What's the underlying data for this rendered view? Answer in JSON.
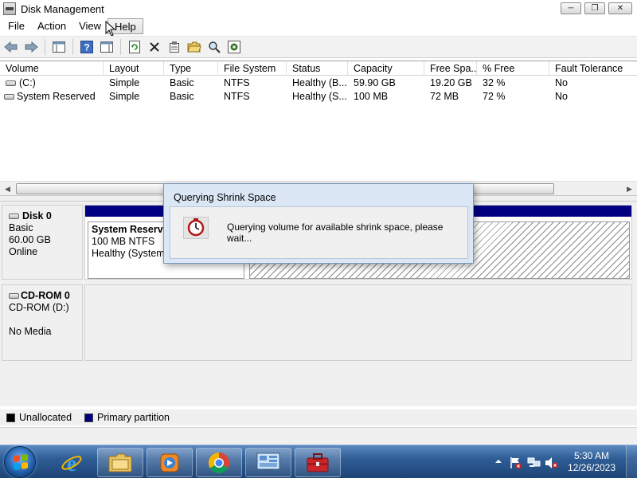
{
  "window": {
    "title": "Disk Management",
    "minimize_glyph": "─",
    "maximize_glyph": "❐",
    "close_glyph": "✕"
  },
  "menu": [
    "File",
    "Action",
    "View",
    "Help"
  ],
  "toolbar_icons": [
    "back-arrow-icon",
    "forward-arrow-icon",
    "show-hide-console-tree-icon",
    "help-icon",
    "show-hide-action-pane-icon",
    "refresh-icon",
    "delete-icon",
    "properties-icon",
    "open-folder-icon",
    "search-icon",
    "settings-icon"
  ],
  "volume_table": {
    "columns": [
      "Volume",
      "Layout",
      "Type",
      "File System",
      "Status",
      "Capacity",
      "Free Spa...",
      "% Free",
      "Fault Tolerance"
    ],
    "rows": [
      [
        "(C:)",
        "Simple",
        "Basic",
        "NTFS",
        "Healthy (B...",
        "59.90 GB",
        "19.20 GB",
        "32 %",
        "No"
      ],
      [
        "System Reserved",
        "Simple",
        "Basic",
        "NTFS",
        "Healthy (S...",
        "100 MB",
        "72 MB",
        "72 %",
        "No"
      ]
    ]
  },
  "disks": {
    "disk0": {
      "name": "Disk 0",
      "type": "Basic",
      "size": "60.00 GB",
      "state": "Online",
      "partition": {
        "name": "System Reserve",
        "size_fs": "100 MB NTFS",
        "status": "Healthy (System,"
      }
    },
    "cdrom0": {
      "name": "CD-ROM 0",
      "drive": "CD-ROM (D:)",
      "media": "No Media"
    }
  },
  "legend": [
    {
      "label": "Unallocated",
      "color": "#000000"
    },
    {
      "label": "Primary partition",
      "color": "#000080"
    }
  ],
  "dialog": {
    "title": "Querying Shrink Space",
    "message": "Querying volume for available shrink space, please wait...",
    "icon": "clock-icon"
  },
  "taskbar": {
    "apps": [
      "internet-explorer-icon",
      "file-explorer-icon",
      "media-player-icon",
      "chrome-icon",
      "computer-management-icon",
      "toolbox-icon"
    ],
    "tray_icons": [
      "show-hidden-icons-arrow",
      "action-center-icon",
      "network-icon",
      "volume-muted-icon"
    ],
    "time": "5:30 AM",
    "date": "12/26/2023"
  },
  "colors": {
    "primary_partition": "#000080",
    "dialog_frame": "#dbe7f5",
    "taskbar": "#2f5d96"
  }
}
